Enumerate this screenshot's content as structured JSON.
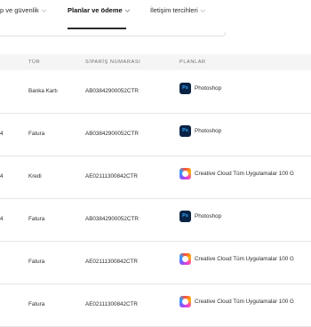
{
  "nav": {
    "tabs": [
      {
        "label": "p ve güvenlik"
      },
      {
        "label": "Planlar ve ödeme"
      },
      {
        "label": "İletişim tercihleri"
      }
    ]
  },
  "table": {
    "headers": {
      "type": "TÜR",
      "order": "SİPARİŞ NUMARASI",
      "plans": "PLANLAR"
    },
    "rows": [
      {
        "first": "",
        "type": "Banka Kartı",
        "order": "AB03842900052CTR",
        "plan": "Photoshop",
        "icon": "photoshop-icon"
      },
      {
        "first": "4",
        "type": "Fatura",
        "order": "AB03842900052CTR",
        "plan": "Photoshop",
        "icon": "photoshop-icon"
      },
      {
        "first": "4",
        "type": "Kredi",
        "order": "AE02111300842CTR",
        "plan": "Creative Cloud Tüm Uygulamalar 100 G",
        "icon": "creative-cloud-icon"
      },
      {
        "first": "4",
        "type": "Fatura",
        "order": "AB03842900052CTR",
        "plan": "Photoshop",
        "icon": "photoshop-icon"
      },
      {
        "first": "",
        "type": "Fatura",
        "order": "AE02111300842CTR",
        "plan": "Creative Cloud Tüm Uygulamalar 100 G",
        "icon": "creative-cloud-icon"
      },
      {
        "first": "",
        "type": "Fatura",
        "order": "AE02111300842CTR",
        "plan": "Creative Cloud Tüm Uygulamalar 100 G",
        "icon": "creative-cloud-icon"
      }
    ]
  },
  "icons": {
    "photoshop_text": "Ps"
  }
}
